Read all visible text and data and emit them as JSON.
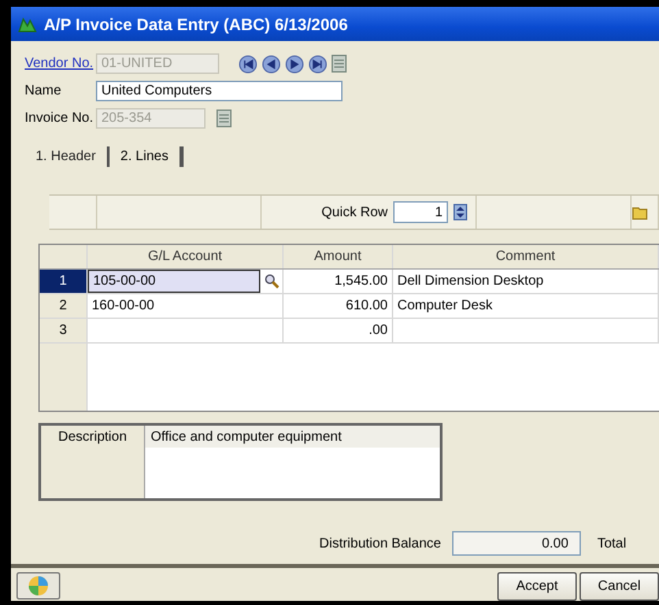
{
  "window": {
    "title": "A/P Invoice Data Entry (ABC) 6/13/2006"
  },
  "header_fields": [
    {
      "label": "Vendor No.",
      "kind": "link",
      "value": "01-UNITED",
      "disabled": true
    },
    {
      "label": "Name",
      "kind": "text",
      "value": "United Computers",
      "disabled": false
    },
    {
      "label": "Invoice No.",
      "kind": "text",
      "value": "205-354",
      "disabled": true
    }
  ],
  "tabs": [
    {
      "label": "1. Header",
      "selected": false
    },
    {
      "label": "2. Lines",
      "selected": true
    }
  ],
  "quick_row": {
    "label": "Quick Row",
    "value": "1"
  },
  "grid": {
    "columns": [
      "G/L Account",
      "Amount",
      "Comment"
    ],
    "rows": [
      {
        "number": "1",
        "account": "105-00-00",
        "amount": "1,545.00",
        "comment": "Dell Dimension Desktop",
        "selected": true
      },
      {
        "number": "2",
        "account": "160-00-00",
        "amount": "610.00",
        "comment": "Computer Desk",
        "selected": false
      },
      {
        "number": "3",
        "account": "",
        "amount": ".00",
        "comment": "",
        "selected": false
      }
    ]
  },
  "description": {
    "label": "Description",
    "value": "Office and computer equipment"
  },
  "distribution_balance": {
    "label": "Distribution Balance",
    "value": "0.00"
  },
  "total_label": "Total",
  "buttons": [
    "Accept",
    "Cancel"
  ]
}
